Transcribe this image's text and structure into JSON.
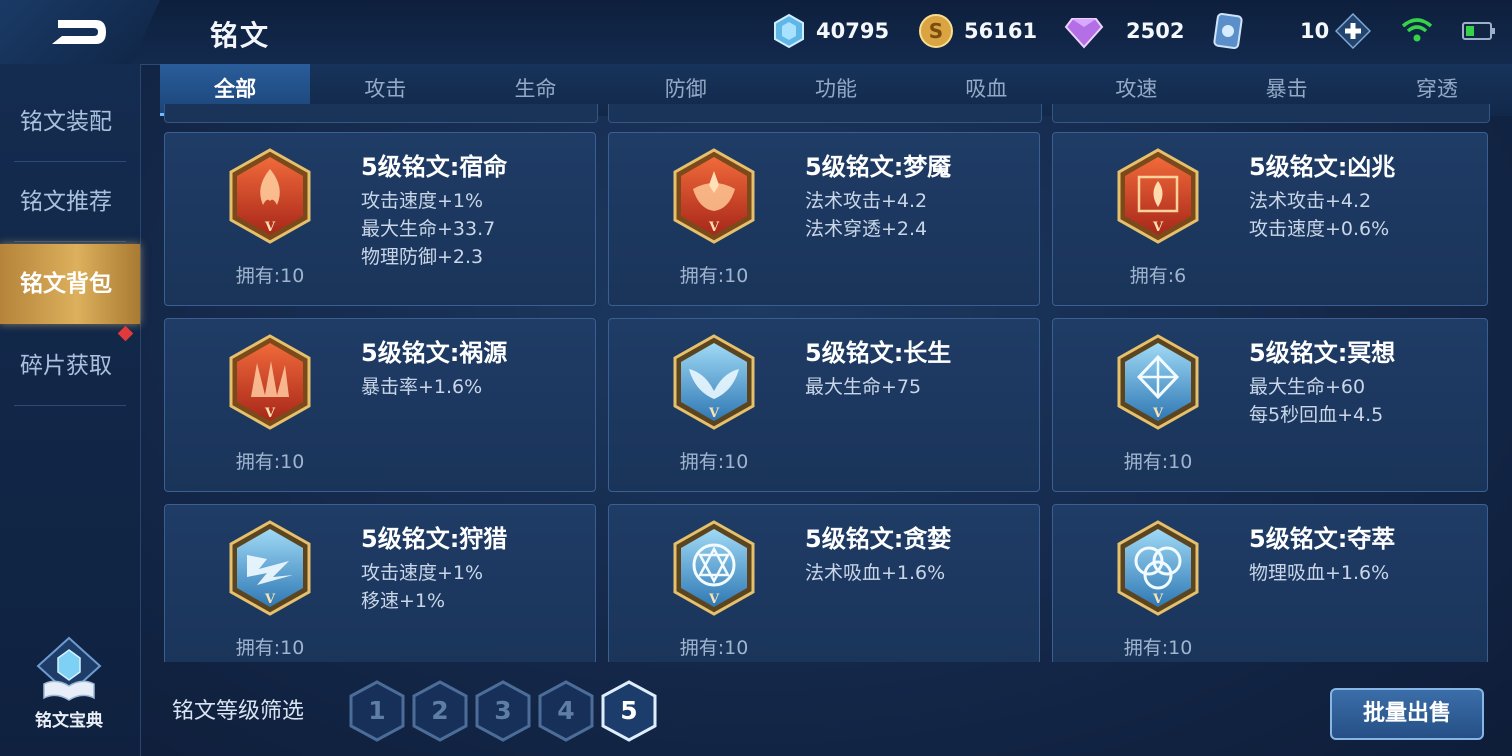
{
  "header": {
    "title": "铭文",
    "currencies": [
      {
        "icon": "crystal-coupon-icon",
        "value": "40795"
      },
      {
        "icon": "gold-coin-icon",
        "value": "56161"
      },
      {
        "icon": "diamond-icon",
        "value": "2502"
      },
      {
        "icon": "inscription-card-icon",
        "value": "10"
      }
    ]
  },
  "tabs": [
    "全部",
    "攻击",
    "生命",
    "防御",
    "功能",
    "吸血",
    "攻速",
    "暴击",
    "穿透"
  ],
  "active_tab": "全部",
  "sidebar": {
    "items": [
      "铭文装配",
      "铭文推荐",
      "铭文背包",
      "碎片获取"
    ],
    "active": "铭文背包",
    "codex_label": "铭文宝典"
  },
  "inscriptions": [
    {
      "name": "5级铭文:宿命",
      "stats": [
        "攻击速度+1%",
        "最大生命+33.7",
        "物理防御+2.3"
      ],
      "owned": "拥有:10",
      "color": "red",
      "icon": "flame-sigil-icon"
    },
    {
      "name": "5级铭文:梦魇",
      "stats": [
        "法术攻击+4.2",
        "法术穿透+2.4"
      ],
      "owned": "拥有:10",
      "color": "red",
      "icon": "lotus-sigil-icon"
    },
    {
      "name": "5级铭文:凶兆",
      "stats": [
        "法术攻击+4.2",
        "攻击速度+0.6%"
      ],
      "owned": "拥有:6",
      "color": "red",
      "icon": "gate-sigil-icon"
    },
    {
      "name": "5级铭文:祸源",
      "stats": [
        "暴击率+1.6%"
      ],
      "owned": "拥有:10",
      "color": "red",
      "icon": "fan-sigil-icon"
    },
    {
      "name": "5级铭文:长生",
      "stats": [
        "最大生命+75"
      ],
      "owned": "拥有:10",
      "color": "blue",
      "icon": "wing-sigil-icon"
    },
    {
      "name": "5级铭文:冥想",
      "stats": [
        "最大生命+60",
        "每5秒回血+4.5"
      ],
      "owned": "拥有:10",
      "color": "blue",
      "icon": "crystal-sigil-icon"
    },
    {
      "name": "5级铭文:狩猎",
      "stats": [
        "攻击速度+1%",
        "移速+1%"
      ],
      "owned": "拥有:10",
      "color": "blue",
      "icon": "lightning-sigil-icon"
    },
    {
      "name": "5级铭文:贪婪",
      "stats": [
        "法术吸血+1.6%"
      ],
      "owned": "拥有:10",
      "color": "blue",
      "icon": "star-ring-sigil-icon"
    },
    {
      "name": "5级铭文:夺萃",
      "stats": [
        "物理吸血+1.6%"
      ],
      "owned": "拥有:10",
      "color": "blue",
      "icon": "knot-sigil-icon"
    }
  ],
  "footer": {
    "filter_label": "铭文等级筛选",
    "levels": [
      "1",
      "2",
      "3",
      "4",
      "5"
    ],
    "active_level": "5",
    "sell_button": "批量出售"
  },
  "colors": {
    "active_tab": "#2a5d9a",
    "sidebar_active": "#dcb05c",
    "red_emblem": "#c8401f",
    "blue_emblem": "#5aa8d8",
    "emblem_gold": "#d8a94a",
    "notification": "#e23a3a"
  }
}
